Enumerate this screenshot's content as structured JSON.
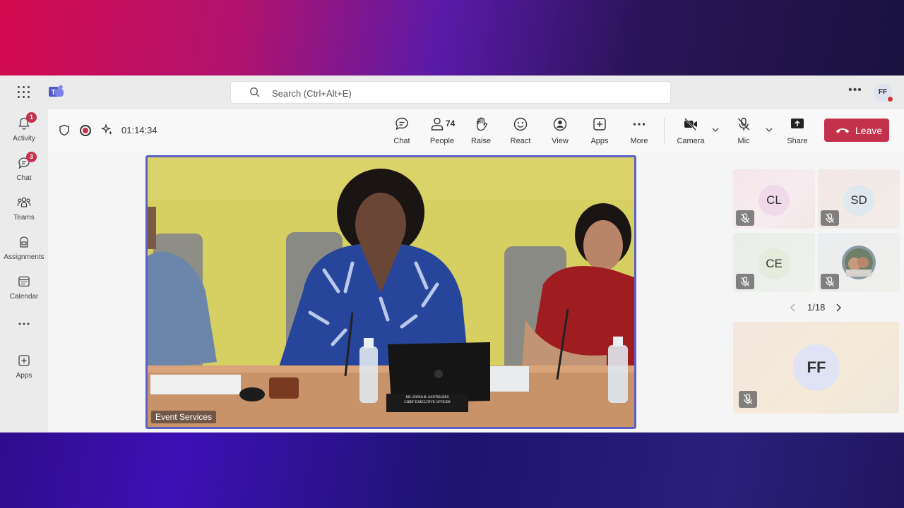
{
  "app": {
    "name": "Microsoft Teams"
  },
  "search": {
    "placeholder": "Search (Ctrl+Alt+E)"
  },
  "user": {
    "initials": "FF",
    "status_color": "#d13438"
  },
  "rail": {
    "items": [
      {
        "label": "Activity",
        "icon": "bell-icon",
        "badge": "1"
      },
      {
        "label": "Chat",
        "icon": "chat-icon",
        "badge": "3"
      },
      {
        "label": "Teams",
        "icon": "teams-icon"
      },
      {
        "label": "Assignments",
        "icon": "backpack-icon"
      },
      {
        "label": "Calendar",
        "icon": "calendar-icon"
      },
      {
        "label": "",
        "icon": "more-icon"
      },
      {
        "label": "Apps",
        "icon": "add-app-icon"
      }
    ]
  },
  "meeting": {
    "timer": "01:14:34",
    "toolbar": {
      "chat": "Chat",
      "people": "People",
      "people_count": "74",
      "raise": "Raise",
      "react": "React",
      "view": "View",
      "apps": "Apps",
      "more": "More",
      "camera": "Camera",
      "mic": "Mic",
      "share": "Share",
      "leave": "Leave"
    },
    "stage": {
      "label": "Event Services",
      "nameplate_line1": "DR. SONIA R. SANTELISES",
      "nameplate_line2": "CHIEF EXECUTIVE OFFICER"
    },
    "gallery": {
      "tiles": [
        {
          "initials": "CL"
        },
        {
          "initials": "SD"
        },
        {
          "initials": "CE"
        },
        {
          "initials": ""
        }
      ],
      "pager": "1/18",
      "self_initials": "FF"
    }
  },
  "colors": {
    "accent": "#5b5fc7",
    "leave": "#c4314b",
    "badge": "#c4314b"
  }
}
